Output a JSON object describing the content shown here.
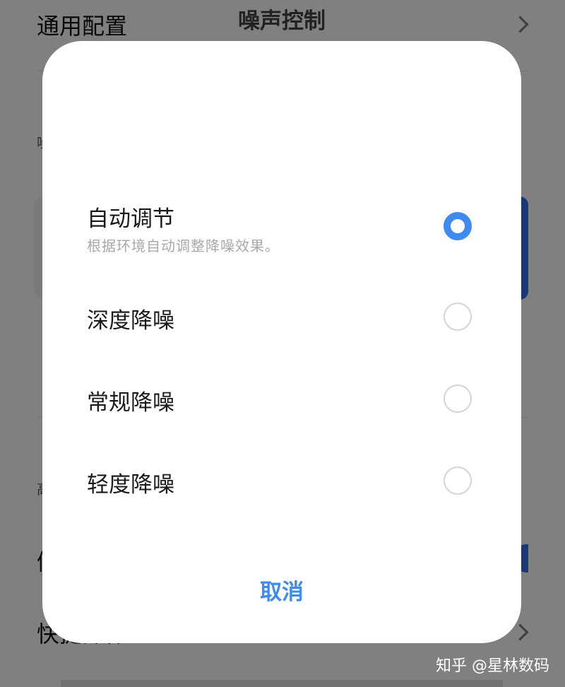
{
  "background": {
    "general_settings_label": "通用配置",
    "bottom_partial_label": "快捷操作",
    "left_fragments": [
      "噪",
      "高",
      "佩"
    ]
  },
  "dialog": {
    "title": "噪声控制",
    "options": [
      {
        "label": "自动调节",
        "description": "根据环境自动调整降噪效果。",
        "selected": true
      },
      {
        "label": "深度降噪",
        "description": "",
        "selected": false
      },
      {
        "label": "常规降噪",
        "description": "",
        "selected": false
      },
      {
        "label": "轻度降噪",
        "description": "",
        "selected": false
      }
    ],
    "cancel_label": "取消"
  },
  "watermark": "知乎 @星林数码",
  "colors": {
    "accent": "#3d8bf0",
    "radio_unchecked": "#d4d4d4",
    "overlay": "rgba(0,0,0,0.48)"
  },
  "icons": {
    "chevron": "chevron-right-icon",
    "radio_checked": "radio-checked-icon",
    "radio_unchecked": "radio-unchecked-icon"
  }
}
